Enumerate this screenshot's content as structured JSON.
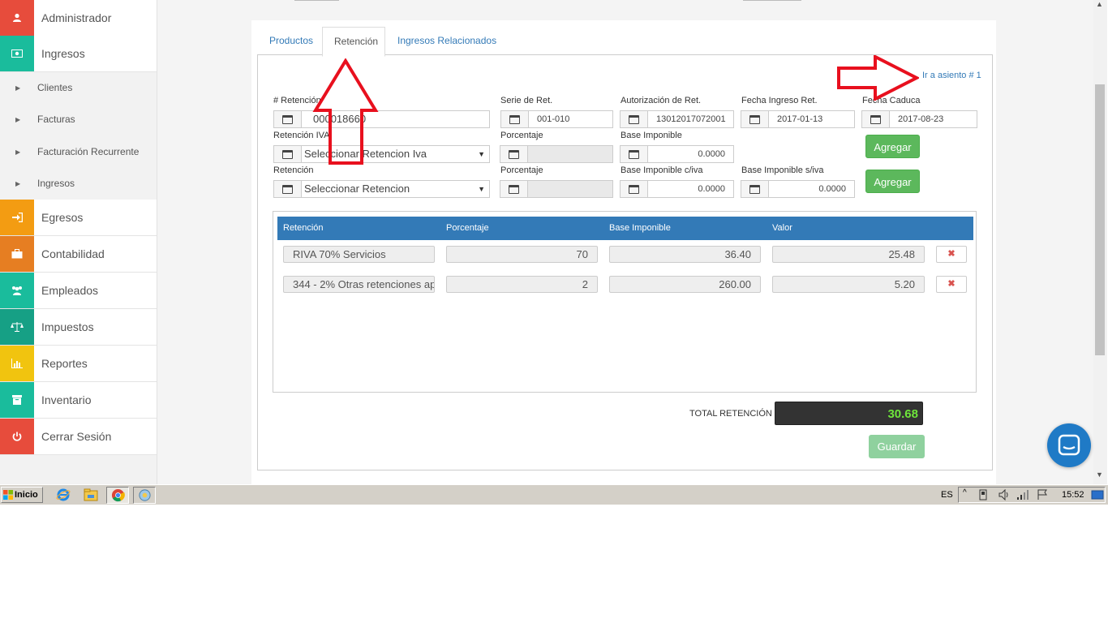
{
  "sidebar": {
    "items": [
      {
        "label": "Administrador",
        "icon": "user-icon",
        "color": "#e74c3c"
      },
      {
        "label": "Ingresos",
        "icon": "money-icon",
        "color": "#1abc9c"
      },
      {
        "label": "Egresos",
        "icon": "sign-in-icon",
        "color": "#f39c12"
      },
      {
        "label": "Contabilidad",
        "icon": "briefcase-icon",
        "color": "#e67e22"
      },
      {
        "label": "Empleados",
        "icon": "users-icon",
        "color": "#1abc9c"
      },
      {
        "label": "Impuestos",
        "icon": "balance-scale-icon",
        "color": "#16a085"
      },
      {
        "label": "Reportes",
        "icon": "bar-chart-icon",
        "color": "#f1c40f"
      },
      {
        "label": "Inventario",
        "icon": "archive-icon",
        "color": "#1abc9c"
      },
      {
        "label": "Cerrar Sesión",
        "icon": "power-icon",
        "color": "#e74c3c"
      }
    ],
    "subitems": [
      "Clientes",
      "Facturas",
      "Facturación Recurrente",
      "Ingresos"
    ]
  },
  "tabs": [
    "Productos",
    "Retención",
    "Ingresos Relacionados"
  ],
  "link_asiento": "Ir a asiento # 1",
  "form": {
    "retencion_num_label": "# Retención",
    "retencion_num_value": "000018660",
    "serie_label": "Serie de Ret.",
    "serie_value": "001-010",
    "autorizacion_label": "Autorización de Ret.",
    "autorizacion_value": "13012017072001",
    "fecha_ingreso_label": "Fecha Ingreso Ret.",
    "fecha_ingreso_value": "2017-01-13",
    "fecha_caduca_label": "Fecha Caduca",
    "fecha_caduca_value": "2017-08-23",
    "ret_iva_label": "Retención IVA",
    "ret_iva_value": "Seleccionar Retencion Iva",
    "porcentaje_label": "Porcentaje",
    "base_imponible_label": "Base Imponible",
    "base_imponible_value": "0.0000",
    "agregar_label": "Agregar",
    "retencion_label": "Retención",
    "retencion_value": "Seleccionar Retencion",
    "porcentaje2_label": "Porcentaje",
    "base_civa_label": "Base Imponible c/iva",
    "base_civa_value": "0.0000",
    "base_siva_label": "Base Imponible s/iva",
    "base_siva_value": "0.0000"
  },
  "table": {
    "headers": [
      "Retención",
      "Porcentaje",
      "Base Imponible",
      "Valor"
    ],
    "rows": [
      {
        "retencion": "RIVA 70% Servicios",
        "porcentaje": "70",
        "base": "36.40",
        "valor": "25.48"
      },
      {
        "retencion": "344 - 2% Otras retenciones ap",
        "porcentaje": "2",
        "base": "260.00",
        "valor": "5.20"
      }
    ],
    "delete_glyph": "✖"
  },
  "total": {
    "label": "TOTAL RETENCIÓN",
    "value": "30.68"
  },
  "guardar_label": "Guardar",
  "taskbar": {
    "start_label": "Inicio",
    "lang": "ES",
    "time": "15:52"
  },
  "colors": {
    "accent": "#337ab7",
    "success": "#5cb85c",
    "annotation": "#e8101e"
  }
}
